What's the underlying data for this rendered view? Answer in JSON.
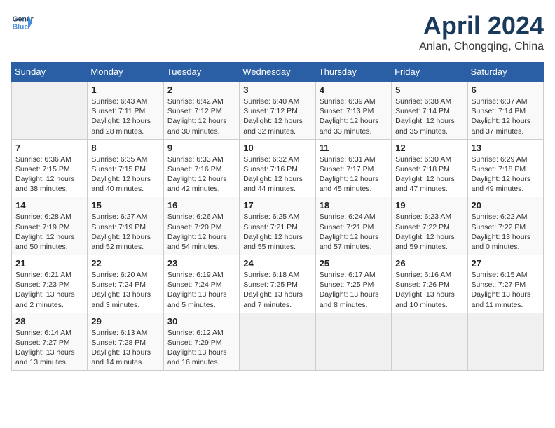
{
  "header": {
    "logo_line1": "General",
    "logo_line2": "Blue",
    "title": "April 2024",
    "subtitle": "Anlan, Chongqing, China"
  },
  "columns": [
    "Sunday",
    "Monday",
    "Tuesday",
    "Wednesday",
    "Thursday",
    "Friday",
    "Saturday"
  ],
  "weeks": [
    [
      {
        "day": "",
        "info": ""
      },
      {
        "day": "1",
        "info": "Sunrise: 6:43 AM\nSunset: 7:11 PM\nDaylight: 12 hours\nand 28 minutes."
      },
      {
        "day": "2",
        "info": "Sunrise: 6:42 AM\nSunset: 7:12 PM\nDaylight: 12 hours\nand 30 minutes."
      },
      {
        "day": "3",
        "info": "Sunrise: 6:40 AM\nSunset: 7:12 PM\nDaylight: 12 hours\nand 32 minutes."
      },
      {
        "day": "4",
        "info": "Sunrise: 6:39 AM\nSunset: 7:13 PM\nDaylight: 12 hours\nand 33 minutes."
      },
      {
        "day": "5",
        "info": "Sunrise: 6:38 AM\nSunset: 7:14 PM\nDaylight: 12 hours\nand 35 minutes."
      },
      {
        "day": "6",
        "info": "Sunrise: 6:37 AM\nSunset: 7:14 PM\nDaylight: 12 hours\nand 37 minutes."
      }
    ],
    [
      {
        "day": "7",
        "info": "Sunrise: 6:36 AM\nSunset: 7:15 PM\nDaylight: 12 hours\nand 38 minutes."
      },
      {
        "day": "8",
        "info": "Sunrise: 6:35 AM\nSunset: 7:15 PM\nDaylight: 12 hours\nand 40 minutes."
      },
      {
        "day": "9",
        "info": "Sunrise: 6:33 AM\nSunset: 7:16 PM\nDaylight: 12 hours\nand 42 minutes."
      },
      {
        "day": "10",
        "info": "Sunrise: 6:32 AM\nSunset: 7:16 PM\nDaylight: 12 hours\nand 44 minutes."
      },
      {
        "day": "11",
        "info": "Sunrise: 6:31 AM\nSunset: 7:17 PM\nDaylight: 12 hours\nand 45 minutes."
      },
      {
        "day": "12",
        "info": "Sunrise: 6:30 AM\nSunset: 7:18 PM\nDaylight: 12 hours\nand 47 minutes."
      },
      {
        "day": "13",
        "info": "Sunrise: 6:29 AM\nSunset: 7:18 PM\nDaylight: 12 hours\nand 49 minutes."
      }
    ],
    [
      {
        "day": "14",
        "info": "Sunrise: 6:28 AM\nSunset: 7:19 PM\nDaylight: 12 hours\nand 50 minutes."
      },
      {
        "day": "15",
        "info": "Sunrise: 6:27 AM\nSunset: 7:19 PM\nDaylight: 12 hours\nand 52 minutes."
      },
      {
        "day": "16",
        "info": "Sunrise: 6:26 AM\nSunset: 7:20 PM\nDaylight: 12 hours\nand 54 minutes."
      },
      {
        "day": "17",
        "info": "Sunrise: 6:25 AM\nSunset: 7:21 PM\nDaylight: 12 hours\nand 55 minutes."
      },
      {
        "day": "18",
        "info": "Sunrise: 6:24 AM\nSunset: 7:21 PM\nDaylight: 12 hours\nand 57 minutes."
      },
      {
        "day": "19",
        "info": "Sunrise: 6:23 AM\nSunset: 7:22 PM\nDaylight: 12 hours\nand 59 minutes."
      },
      {
        "day": "20",
        "info": "Sunrise: 6:22 AM\nSunset: 7:22 PM\nDaylight: 13 hours\nand 0 minutes."
      }
    ],
    [
      {
        "day": "21",
        "info": "Sunrise: 6:21 AM\nSunset: 7:23 PM\nDaylight: 13 hours\nand 2 minutes."
      },
      {
        "day": "22",
        "info": "Sunrise: 6:20 AM\nSunset: 7:24 PM\nDaylight: 13 hours\nand 3 minutes."
      },
      {
        "day": "23",
        "info": "Sunrise: 6:19 AM\nSunset: 7:24 PM\nDaylight: 13 hours\nand 5 minutes."
      },
      {
        "day": "24",
        "info": "Sunrise: 6:18 AM\nSunset: 7:25 PM\nDaylight: 13 hours\nand 7 minutes."
      },
      {
        "day": "25",
        "info": "Sunrise: 6:17 AM\nSunset: 7:25 PM\nDaylight: 13 hours\nand 8 minutes."
      },
      {
        "day": "26",
        "info": "Sunrise: 6:16 AM\nSunset: 7:26 PM\nDaylight: 13 hours\nand 10 minutes."
      },
      {
        "day": "27",
        "info": "Sunrise: 6:15 AM\nSunset: 7:27 PM\nDaylight: 13 hours\nand 11 minutes."
      }
    ],
    [
      {
        "day": "28",
        "info": "Sunrise: 6:14 AM\nSunset: 7:27 PM\nDaylight: 13 hours\nand 13 minutes."
      },
      {
        "day": "29",
        "info": "Sunrise: 6:13 AM\nSunset: 7:28 PM\nDaylight: 13 hours\nand 14 minutes."
      },
      {
        "day": "30",
        "info": "Sunrise: 6:12 AM\nSunset: 7:29 PM\nDaylight: 13 hours\nand 16 minutes."
      },
      {
        "day": "",
        "info": ""
      },
      {
        "day": "",
        "info": ""
      },
      {
        "day": "",
        "info": ""
      },
      {
        "day": "",
        "info": ""
      }
    ]
  ]
}
